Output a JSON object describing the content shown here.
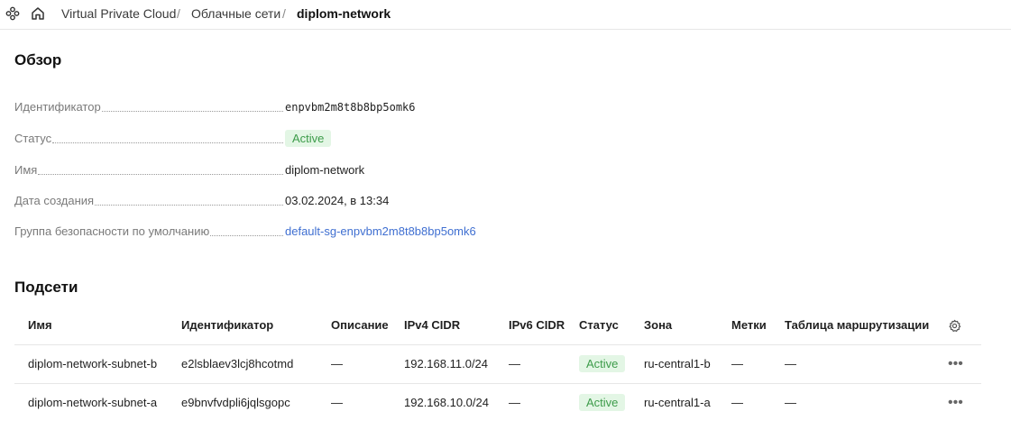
{
  "breadcrumb": {
    "items": [
      "Virtual Private Cloud",
      "Облачные сети",
      "diplom-network"
    ],
    "separator": "/"
  },
  "overview": {
    "title": "Обзор",
    "fields": [
      {
        "label": "Идентификатор",
        "value": "enpvbm2m8t8b8bp5omk6"
      },
      {
        "label": "Статус",
        "value": "Active"
      },
      {
        "label": "Имя",
        "value": "diplom-network"
      },
      {
        "label": "Дата создания",
        "value": "03.02.2024, в 13:34"
      },
      {
        "label": "Группа безопасности по умолчанию",
        "value": "default-sg-enpvbm2m8t8b8bp5omk6"
      }
    ]
  },
  "subnets": {
    "title": "Подсети",
    "columns": [
      "Имя",
      "Идентификатор",
      "Описание",
      "IPv4 CIDR",
      "IPv6 CIDR",
      "Статус",
      "Зона",
      "Метки",
      "Таблица маршрутизации"
    ],
    "rows": [
      {
        "name": "diplom-network-subnet-b",
        "id": "e2lsblaev3lcj8hcotmd",
        "description": "—",
        "ipv4": "192.168.11.0/24",
        "ipv6": "—",
        "status": "Active",
        "zone": "ru-central1-b",
        "labels": "—",
        "route_table": "—",
        "menu": "•••"
      },
      {
        "name": "diplom-network-subnet-a",
        "id": "e9bnvfvdpli6jqlsgopc",
        "description": "—",
        "ipv4": "192.168.10.0/24",
        "ipv6": "—",
        "status": "Active",
        "zone": "ru-central1-a",
        "labels": "—",
        "route_table": "—",
        "menu": "•••"
      }
    ]
  },
  "icons": {
    "app": "services-icon",
    "home": "home-icon",
    "settings": "gear-icon",
    "row_menu": "more-horizontal-icon"
  },
  "colors": {
    "status_bg": "#e3f6e5",
    "status_text": "#3d9c4a",
    "link": "#3f6fd1"
  }
}
